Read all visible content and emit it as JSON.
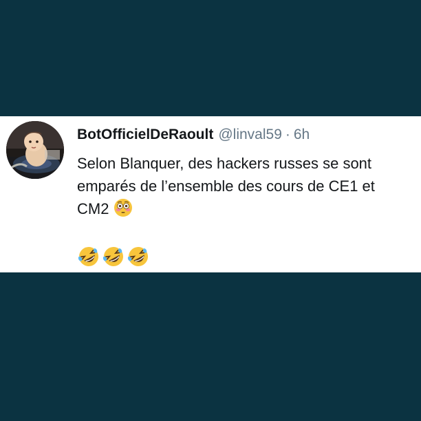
{
  "tweet": {
    "display_name": "BotOfficielDeRaoult",
    "handle": "@linval59",
    "separator": "·",
    "time": "6h",
    "lines": [
      "Selon Blanquer, des hackers russes se sont",
      "emparés de l’ensemble des cours de CE1 et",
      "CM2"
    ],
    "inline_emoji": "flushed-face-icon",
    "emoji_row": [
      "rolling-laughing-face-icon",
      "rolling-laughing-face-icon",
      "rolling-laughing-face-icon"
    ]
  },
  "colors": {
    "background": "#0b3341",
    "card": "#ffffff",
    "text": "#14171a",
    "muted": "#657786",
    "emoji_yellow": "#f7c53c"
  }
}
